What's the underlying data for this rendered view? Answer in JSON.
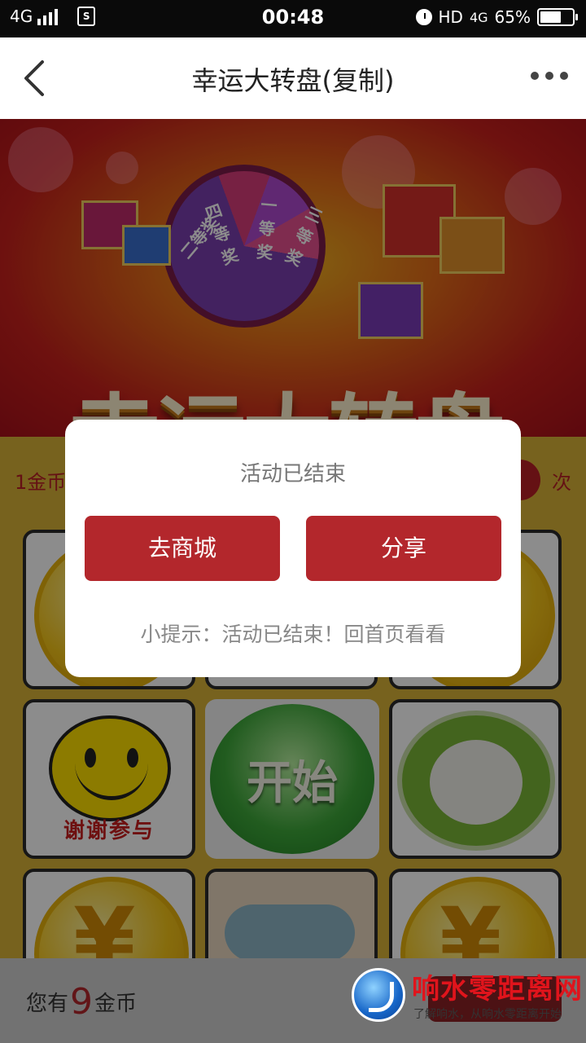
{
  "status_bar": {
    "network_left": "4G",
    "time": "00:48",
    "hd_label": "HD",
    "network_right": "4G",
    "battery": "65%",
    "battery_level": 0.65,
    "sim_label": "S"
  },
  "nav": {
    "title": "幸运大转盘(复制)"
  },
  "banner": {
    "title": "幸运大转盘",
    "wheel_labels": [
      "二等奖",
      "四等奖",
      "一等奖",
      "三等奖"
    ]
  },
  "game": {
    "left_label": "1金币",
    "right_label": "次",
    "start_label": "开始",
    "thanks_label": "谢谢参与",
    "coin_symbol": "¥"
  },
  "modal": {
    "title": "活动已结束",
    "shop_button": "去商城",
    "share_button": "分享",
    "tip": "小提示：活动已结束！回首页看看"
  },
  "bottom": {
    "balance_prefix": "您有",
    "balance_value": "9",
    "balance_suffix": "金币"
  },
  "watermark": {
    "title": "响水零距离网",
    "subtitle": "了解响水，从响水零距离开始"
  },
  "colors": {
    "accent": "#b3272c",
    "game_background": "#d9b338",
    "banner_red": "#c8201c"
  }
}
